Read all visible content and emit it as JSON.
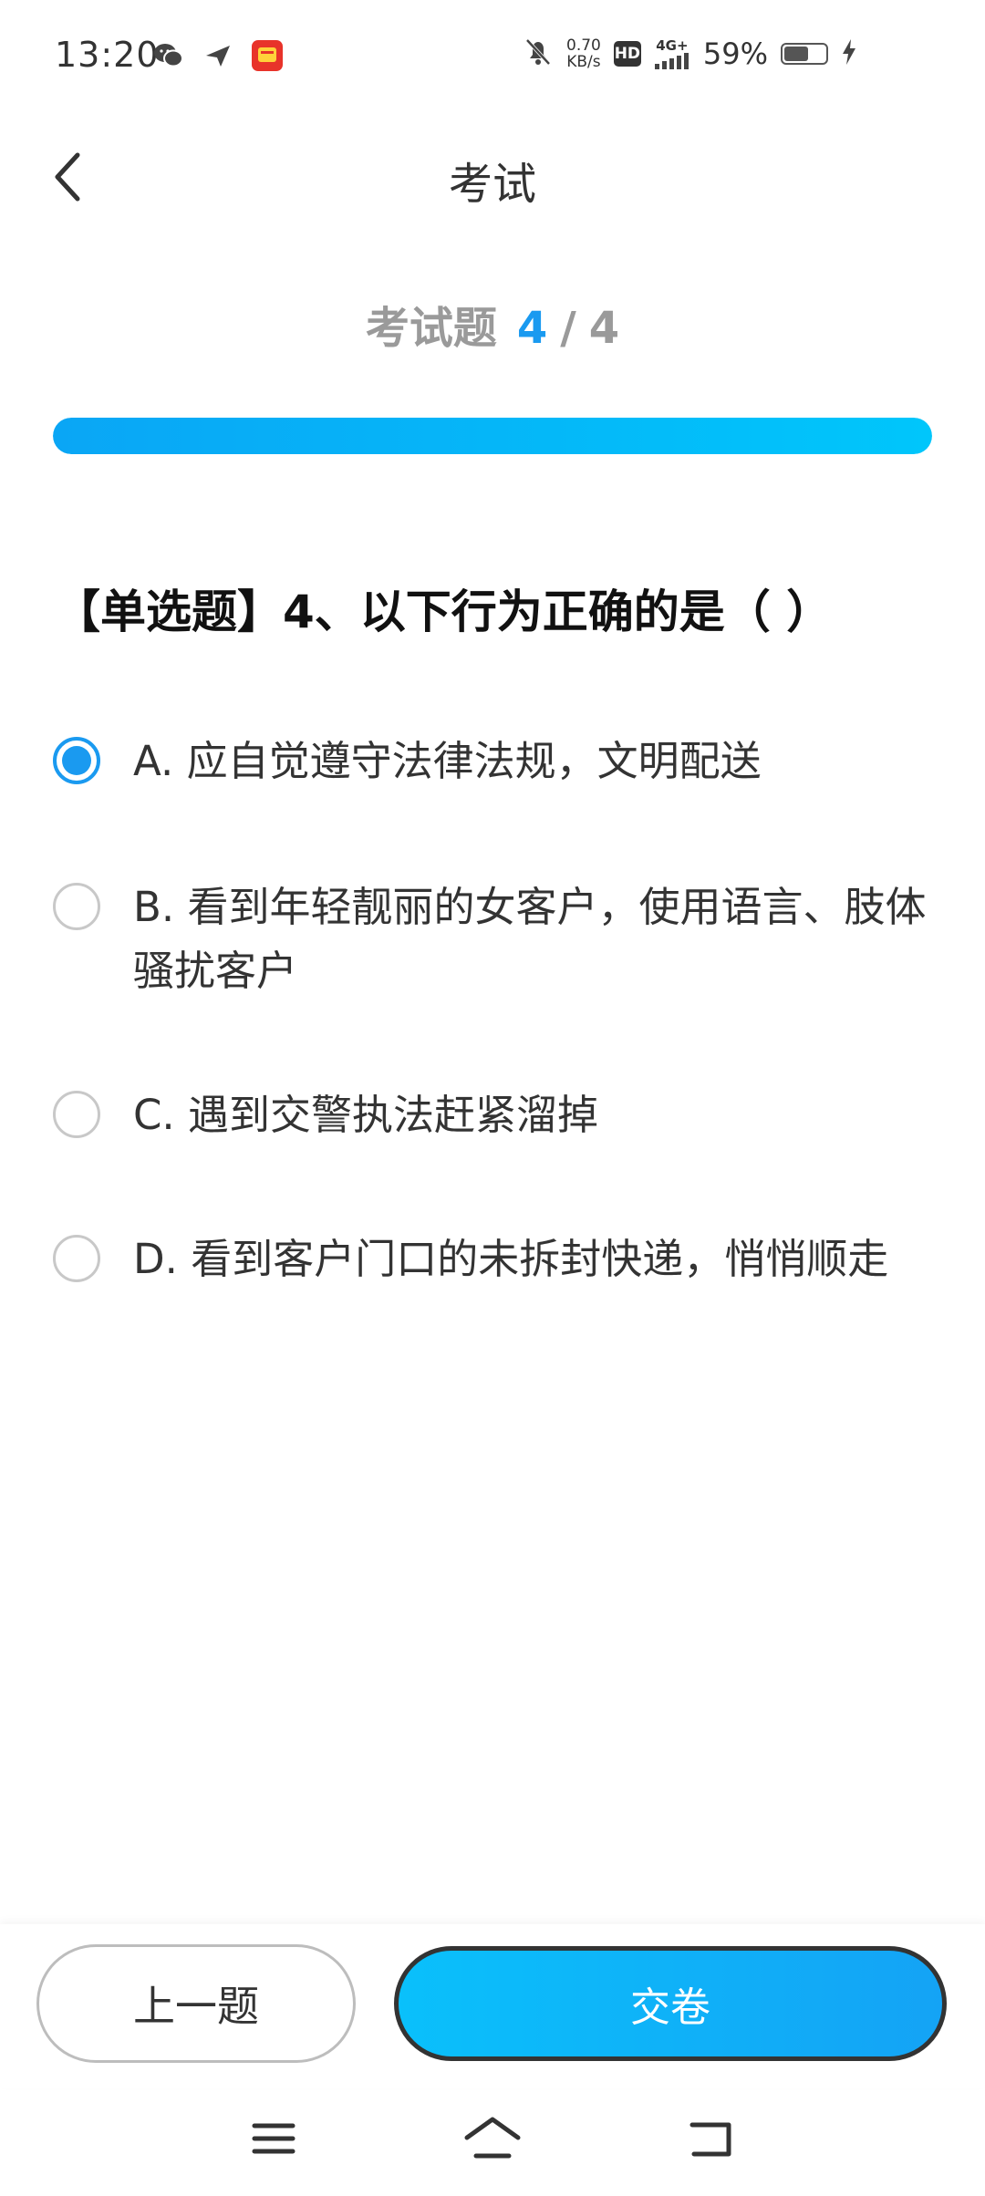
{
  "status_bar": {
    "time": "13:20",
    "net_speed_value": "0.70",
    "net_speed_unit": "KB/s",
    "hd_label": "HD",
    "signal_label": "4G+",
    "battery_percent": "59%",
    "battery_level": 0.59,
    "left_icons": [
      "wechat-icon",
      "send-icon",
      "taobao-app-icon"
    ],
    "right_icons": [
      "mute-bell-icon",
      "signal-icon",
      "battery-icon",
      "charging-icon"
    ]
  },
  "header": {
    "title": "考试",
    "back_icon": "chevron-left-icon"
  },
  "progress": {
    "label": "考试题",
    "current": "4",
    "separator": "/",
    "total": "4",
    "fraction": 1.0,
    "colors": {
      "start": "#0aa6f5",
      "end": "#00c6fb"
    }
  },
  "question": {
    "text": "【单选题】4、以下行为正确的是（ ）"
  },
  "options": [
    {
      "text": "A. 应自觉遵守法律法规，文明配送",
      "selected": true
    },
    {
      "text": "B. 看到年轻靓丽的女客户，使用语言、肢体骚扰客户",
      "selected": false
    },
    {
      "text": "C. 遇到交警执法赶紧溜掉",
      "selected": false
    },
    {
      "text": "D. 看到客户门口的未拆封快递，悄悄顺走",
      "selected": false
    }
  ],
  "actions": {
    "prev_label": "上一题",
    "submit_label": "交卷"
  },
  "accent_color": "#1a9af0",
  "nav_bar": {
    "icons": [
      "menu-icon",
      "home-icon",
      "back-icon"
    ]
  }
}
